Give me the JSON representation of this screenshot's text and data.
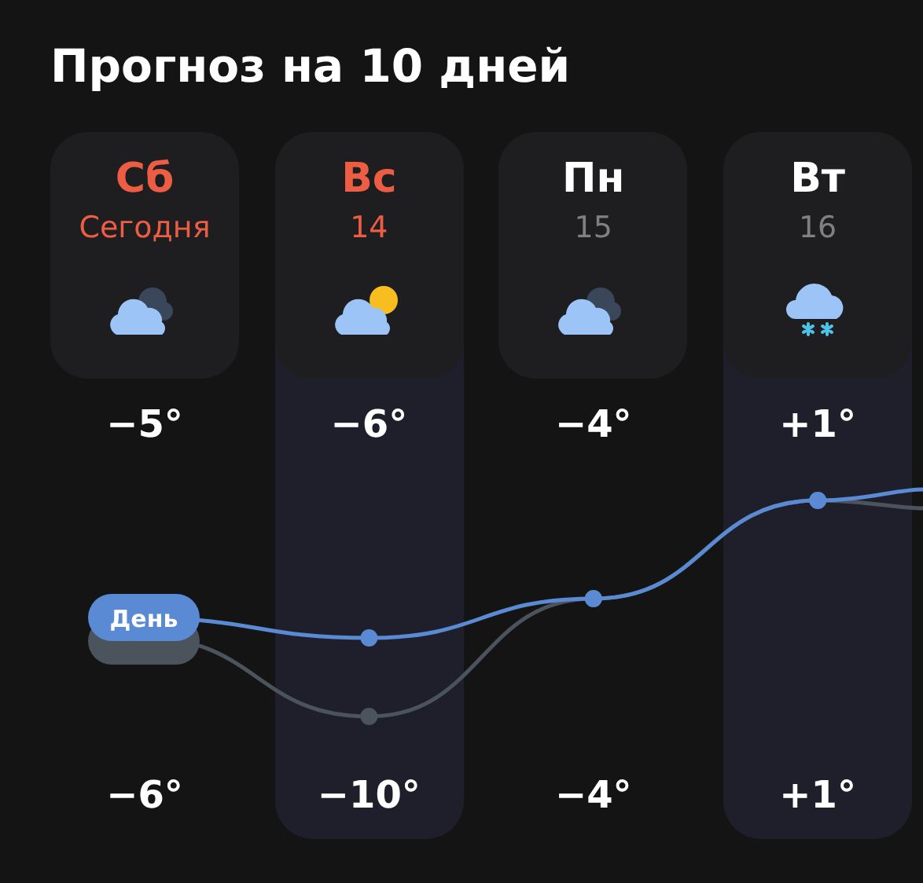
{
  "title": "Прогноз на 10 дней",
  "days": [
    {
      "day": "Сб",
      "date": "Сегодня",
      "weekend": true,
      "shaded": false,
      "kind": "cloudy-night",
      "day_temp": "−5°",
      "night_temp": "−6°"
    },
    {
      "day": "Вс",
      "date": "14",
      "weekend": true,
      "shaded": true,
      "kind": "partly-sunny",
      "day_temp": "−6°",
      "night_temp": "−10°"
    },
    {
      "day": "Пн",
      "date": "15",
      "weekend": false,
      "shaded": false,
      "kind": "cloudy-night",
      "day_temp": "−4°",
      "night_temp": "−4°"
    },
    {
      "day": "Вт",
      "date": "16",
      "weekend": false,
      "shaded": true,
      "kind": "snow",
      "day_temp": "+1°",
      "night_temp": "+1°"
    }
  ],
  "legend": {
    "day_label": "День"
  }
}
